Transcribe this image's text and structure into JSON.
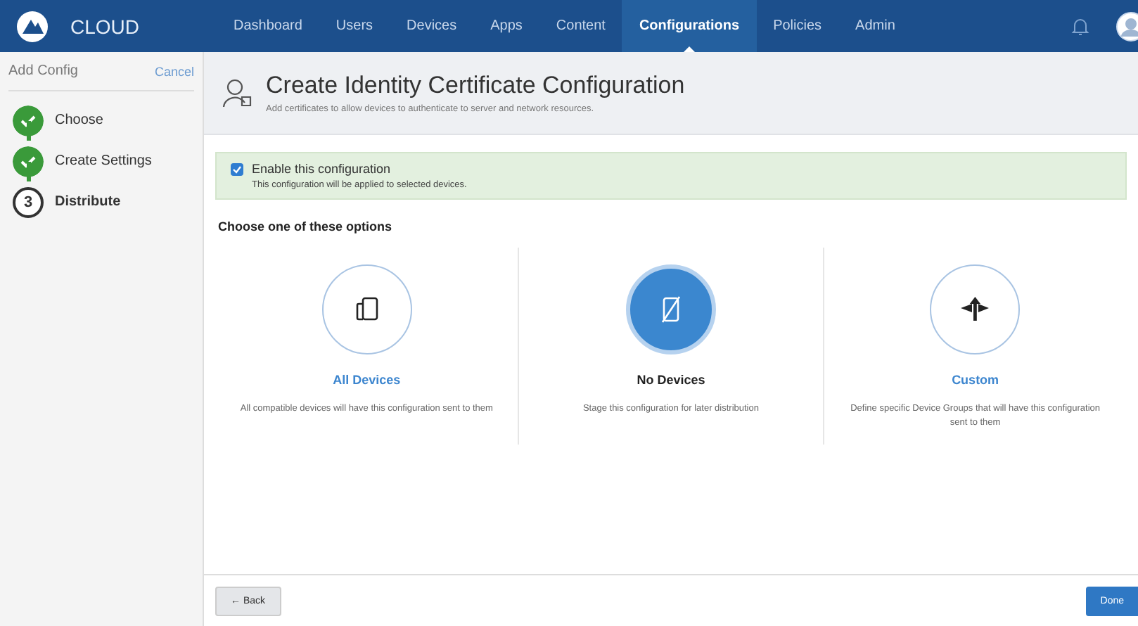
{
  "nav": {
    "brand": "CLOUD",
    "items": [
      {
        "label": "Dashboard",
        "selected": false
      },
      {
        "label": "Users",
        "selected": false
      },
      {
        "label": "Devices",
        "selected": false
      },
      {
        "label": "Apps",
        "selected": false
      },
      {
        "label": "Content",
        "selected": false
      },
      {
        "label": "Configurations",
        "selected": true
      },
      {
        "label": "Policies",
        "selected": false
      },
      {
        "label": "Admin",
        "selected": false
      }
    ]
  },
  "sidebar": {
    "title": "Add Config",
    "cancel": "Cancel",
    "steps": [
      {
        "label": "Choose",
        "kind": "done"
      },
      {
        "label": "Create Settings",
        "kind": "done"
      },
      {
        "label": "Distribute",
        "kind": "current",
        "number": "3"
      }
    ]
  },
  "header": {
    "title": "Create Identity Certificate Configuration",
    "subtitle": "Add certificates to allow devices to authenticate to server and network resources."
  },
  "enable": {
    "label": "Enable this configuration",
    "note": "This configuration will be applied to selected devices.",
    "checked": true
  },
  "options_heading": "Choose one of these options",
  "options": [
    {
      "title": "All Devices",
      "description": "All compatible devices will have this configuration sent to them",
      "selected": false
    },
    {
      "title": "No Devices",
      "description": "Stage this configuration for later distribution",
      "selected": true
    },
    {
      "title": "Custom",
      "description": "Define specific Device Groups that will have this configuration sent to them",
      "selected": false
    }
  ],
  "footer": {
    "back": "← Back",
    "done": "Done"
  }
}
